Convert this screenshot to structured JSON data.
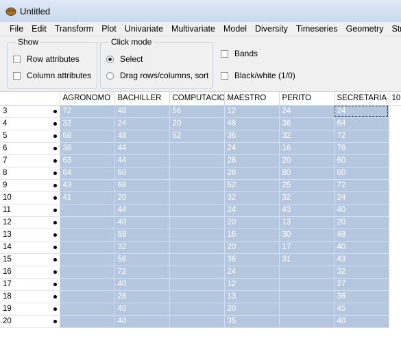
{
  "window": {
    "title": "Untitled"
  },
  "menu": [
    "File",
    "Edit",
    "Transform",
    "Plot",
    "Univariate",
    "Multivariate",
    "Model",
    "Diversity",
    "Timeseries",
    "Geometry",
    "Str"
  ],
  "show": {
    "title": "Show",
    "row_attributes": "Row attributes",
    "column_attributes": "Column attributes"
  },
  "click_mode": {
    "title": "Click mode",
    "select": "Select",
    "drag": "Drag rows/columns, sort",
    "selected": "select"
  },
  "options": {
    "bands": "Bands",
    "black_white": "Black/white (1/0)"
  },
  "columns": [
    "AGRONOMO",
    "BACHILLER",
    "COMPUTACION",
    "MAESTRO",
    "PERITO",
    "SECRETARIA",
    "10"
  ],
  "rows": [
    {
      "label": "3",
      "values": [
        "72",
        "48",
        "56",
        "12",
        "24",
        "24"
      ]
    },
    {
      "label": "4",
      "values": [
        "32",
        "24",
        "20",
        "48",
        "36",
        "64"
      ]
    },
    {
      "label": "5",
      "values": [
        "68",
        "48",
        "52",
        "36",
        "32",
        "72"
      ]
    },
    {
      "label": "6",
      "values": [
        "38",
        "44",
        "",
        "24",
        "16",
        "76"
      ]
    },
    {
      "label": "7",
      "values": [
        "63",
        "44",
        "",
        "28",
        "20",
        "60"
      ]
    },
    {
      "label": "8",
      "values": [
        "64",
        "60",
        "",
        "28",
        "80",
        "60"
      ]
    },
    {
      "label": "9",
      "values": [
        "43",
        "68",
        "",
        "52",
        "25",
        "72"
      ]
    },
    {
      "label": "10",
      "values": [
        "41",
        "20",
        "",
        "32",
        "32",
        "24"
      ]
    },
    {
      "label": "11",
      "values": [
        "",
        "44",
        "",
        "24",
        "43",
        "40"
      ]
    },
    {
      "label": "12",
      "values": [
        "",
        "40",
        "",
        "20",
        "13",
        "20"
      ]
    },
    {
      "label": "13",
      "values": [
        "",
        "68",
        "",
        "16",
        "30",
        "48"
      ]
    },
    {
      "label": "14",
      "values": [
        "",
        "32",
        "",
        "20",
        "17",
        "40"
      ]
    },
    {
      "label": "15",
      "values": [
        "",
        "56",
        "",
        "36",
        "31",
        "43"
      ]
    },
    {
      "label": "16",
      "values": [
        "",
        "72",
        "",
        "24",
        "",
        "32"
      ]
    },
    {
      "label": "17",
      "values": [
        "",
        "40",
        "",
        "12",
        "",
        "27"
      ]
    },
    {
      "label": "18",
      "values": [
        "",
        "28",
        "",
        "13",
        "",
        "36"
      ]
    },
    {
      "label": "19",
      "values": [
        "",
        "40",
        "",
        "20",
        "",
        "45"
      ]
    },
    {
      "label": "20",
      "values": [
        "",
        "40",
        "",
        "35",
        "",
        "40"
      ]
    }
  ],
  "colors": {
    "cell_bg": "#b5c7de",
    "cell_text": "#ffffff",
    "chrome": "#f0f0f0"
  }
}
